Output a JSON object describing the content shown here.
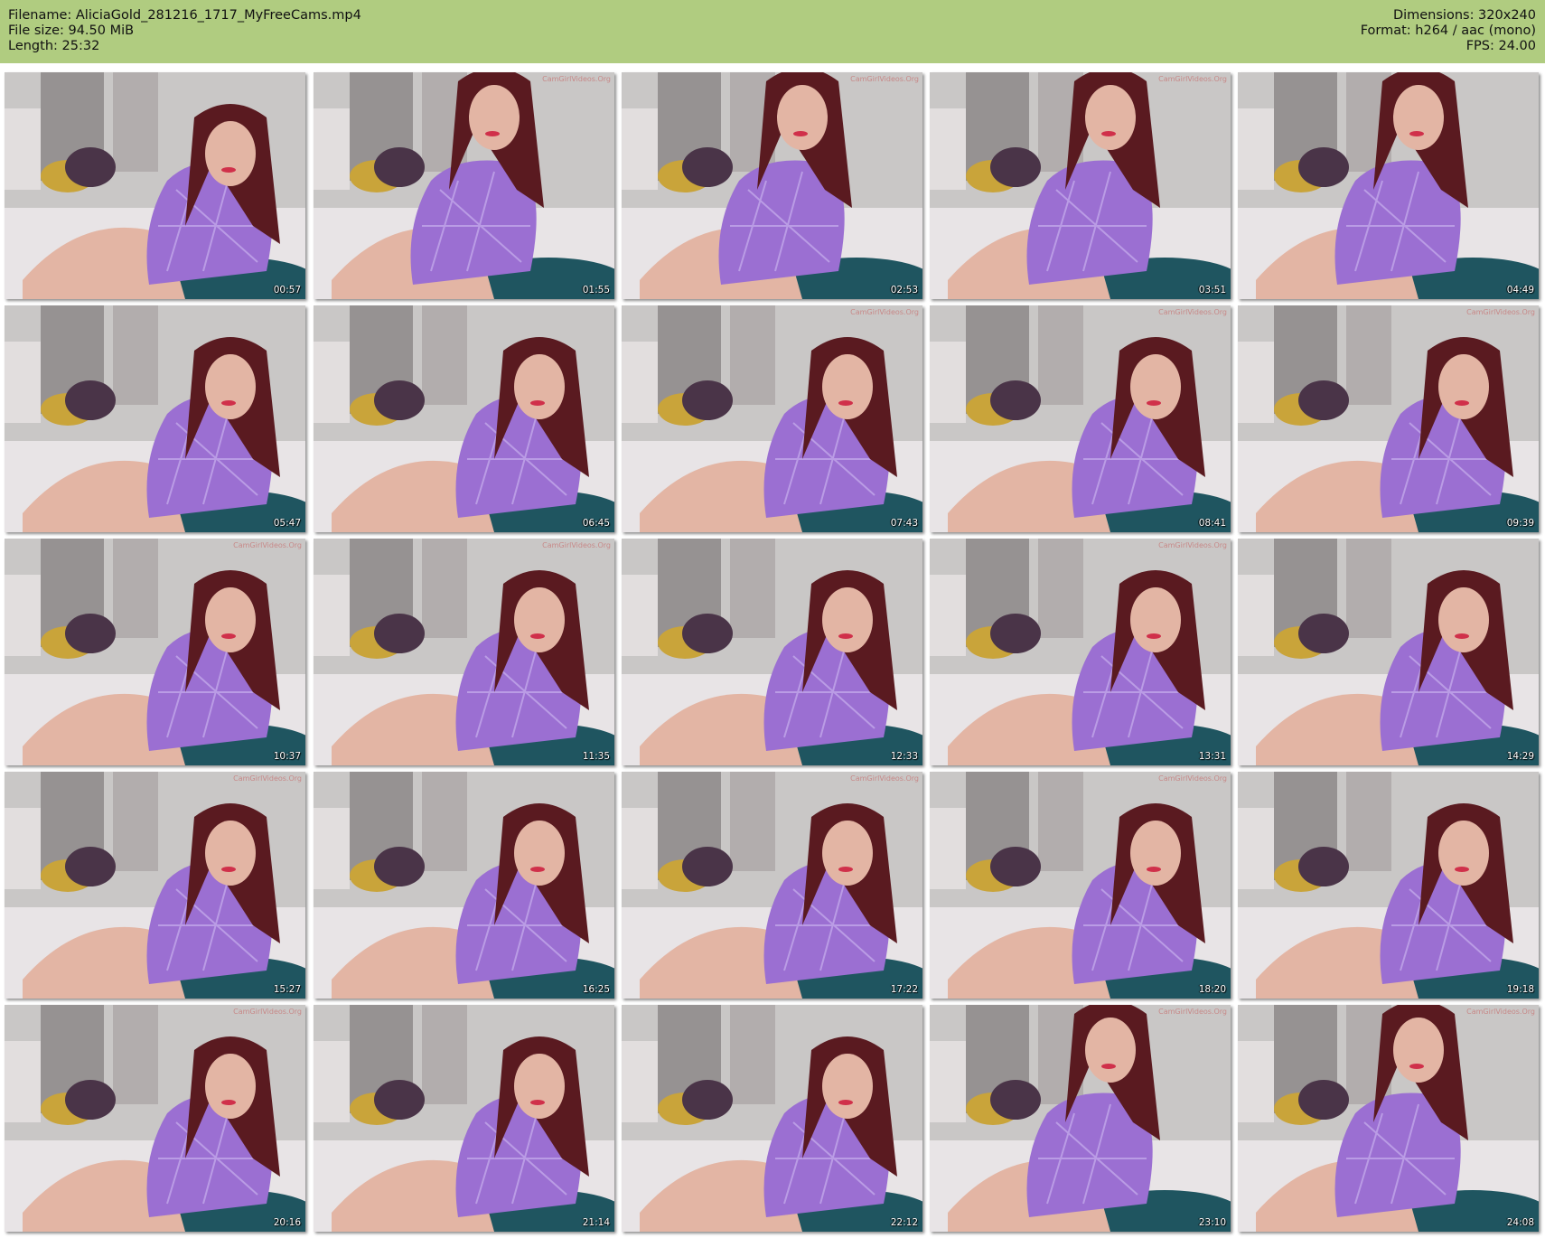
{
  "meta": {
    "filename": "Filename: AliciaGold_281216_1717_MyFreeCams.mp4",
    "filesize": "File size: 94.50 MiB",
    "length": "Length: 25:32",
    "dimensions": "Dimensions: 320x240",
    "format": "Format: h264 / aac (mono)",
    "fps": "FPS: 24.00"
  },
  "thumbnails": [
    {
      "time": "00:57",
      "watermark": ""
    },
    {
      "time": "01:55",
      "watermark": "CamGirlVideos.Org"
    },
    {
      "time": "02:53",
      "watermark": "CamGirlVideos.Org"
    },
    {
      "time": "03:51",
      "watermark": "CamGirlVideos.Org"
    },
    {
      "time": "04:49",
      "watermark": ""
    },
    {
      "time": "05:47",
      "watermark": ""
    },
    {
      "time": "06:45",
      "watermark": ""
    },
    {
      "time": "07:43",
      "watermark": "CamGirlVideos.Org"
    },
    {
      "time": "08:41",
      "watermark": "CamGirlVideos.Org"
    },
    {
      "time": "09:39",
      "watermark": "CamGirlVideos.Org"
    },
    {
      "time": "10:37",
      "watermark": "CamGirlVideos.Org"
    },
    {
      "time": "11:35",
      "watermark": "CamGirlVideos.Org"
    },
    {
      "time": "12:33",
      "watermark": ""
    },
    {
      "time": "13:31",
      "watermark": "CamGirlVideos.Org"
    },
    {
      "time": "14:29",
      "watermark": ""
    },
    {
      "time": "15:27",
      "watermark": "CamGirlVideos.Org"
    },
    {
      "time": "16:25",
      "watermark": ""
    },
    {
      "time": "17:22",
      "watermark": "CamGirlVideos.Org"
    },
    {
      "time": "18:20",
      "watermark": "CamGirlVideos.Org"
    },
    {
      "time": "19:18",
      "watermark": ""
    },
    {
      "time": "20:16",
      "watermark": "CamGirlVideos.Org"
    },
    {
      "time": "21:14",
      "watermark": ""
    },
    {
      "time": "22:12",
      "watermark": ""
    },
    {
      "time": "23:10",
      "watermark": "CamGirlVideos.Org"
    },
    {
      "time": "24:08",
      "watermark": "CamGirlVideos.Org"
    }
  ],
  "colors": {
    "header_bg": "#b0cc80",
    "wall": "#c9c7c6",
    "curtain": "#8a8584",
    "bed": "#e8e4e6",
    "pillow_yellow": "#c9a43a",
    "pillow_purple": "#4a3448",
    "cushion_teal": "#1f5560",
    "lace_purple": "#9b6fd2",
    "hair": "#5a1a20",
    "skin": "#e3b5a4"
  }
}
